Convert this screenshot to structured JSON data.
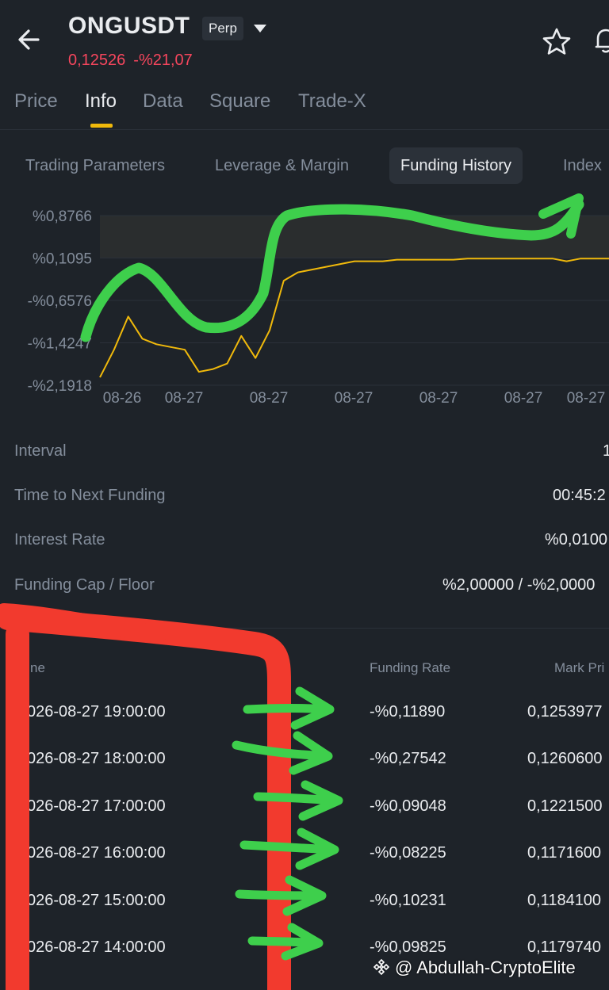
{
  "header": {
    "symbol": "ONGUSDT",
    "contract_badge": "Perp",
    "last_price": "0,12526",
    "change_pct": "-%21,07",
    "icons": [
      "back-arrow-icon",
      "dropdown-caret-icon",
      "star-icon",
      "bell-icon"
    ]
  },
  "tabs": [
    "Price",
    "Info",
    "Data",
    "Square",
    "Trade-X"
  ],
  "active_tab": "Info",
  "subtabs": [
    "Trading Parameters",
    "Leverage & Margin",
    "Funding History",
    "Index"
  ],
  "active_subtab": "Funding History",
  "chart_data": {
    "type": "line",
    "y_ticks": [
      "%0,8766",
      "%0,1095",
      "-%0,6576",
      "-%1,4247",
      "-%2,1918"
    ],
    "x_ticks": [
      "08-26",
      "08-27",
      "08-27",
      "08-27",
      "08-27",
      "08-27",
      "08-27"
    ],
    "ylim": [
      -2.1918,
      0.8766
    ],
    "series": [
      {
        "color": "#f0b90b",
        "x": [
          0,
          1,
          2,
          3,
          4,
          5,
          6,
          7,
          8,
          9,
          10,
          11,
          12,
          13,
          14,
          15,
          16,
          17,
          18,
          19,
          20,
          21,
          22,
          23,
          24,
          25,
          26,
          27,
          28,
          29,
          30,
          31,
          32,
          33,
          34,
          35,
          36
        ],
        "values": [
          -2.05,
          -1.55,
          -0.95,
          -1.35,
          -1.45,
          -1.5,
          -1.55,
          -1.95,
          -1.9,
          -1.8,
          -1.3,
          -1.7,
          -1.2,
          -0.3,
          -0.15,
          -0.1,
          -0.05,
          0.0,
          0.05,
          0.05,
          0.05,
          0.08,
          0.08,
          0.08,
          0.08,
          0.08,
          0.1,
          0.1,
          0.1,
          0.1,
          0.1,
          0.1,
          0.1,
          0.05,
          0.1,
          0.1,
          0.1
        ]
      }
    ],
    "grid": true,
    "shaded_band": [
      0.1095,
      0.8766
    ]
  },
  "info_rows": [
    {
      "label": "Interval",
      "value": "1"
    },
    {
      "label": "Time to Next Funding",
      "value": "00:45:2"
    },
    {
      "label": "Interest Rate",
      "value": "%0,0100"
    },
    {
      "label": "Funding Cap / Floor",
      "value": "%2,00000 / -%2,0000"
    }
  ],
  "table": {
    "headers": [
      "ne",
      "Funding Rate",
      "Mark Pri"
    ],
    "rows": [
      [
        "026-08-27 19:00:00",
        "-%0,11890",
        "0,1253977"
      ],
      [
        "026-08-27 18:00:00",
        "-%0,27542",
        "0,1260600"
      ],
      [
        "026-08-27 17:00:00",
        "-%0,09048",
        "0,1221500"
      ],
      [
        "026-08-27 16:00:00",
        "-%0,08225",
        "0,1171600"
      ],
      [
        "026-08-27 15:00:00",
        "-%0,10231",
        "0,1184100"
      ],
      [
        "026-08-27 14:00:00",
        "-%0,09825",
        "0,1179740"
      ]
    ]
  },
  "annotation_colors": {
    "green": "#3ecf4c",
    "red": "#f23a2e"
  },
  "watermark": "@ Abdullah-CryptoElite"
}
